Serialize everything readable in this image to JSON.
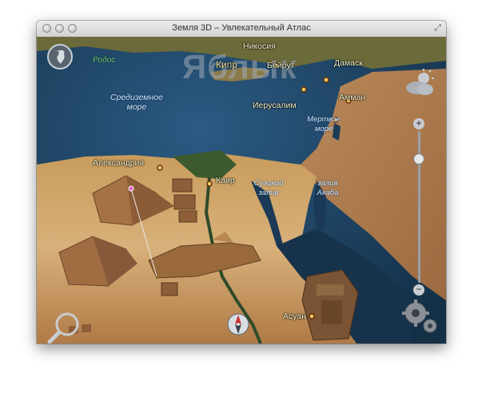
{
  "window": {
    "title": "Земля 3D – Увлекательный Атлас"
  },
  "watermark": "Яблык",
  "cities": [
    {
      "key": "nicosia",
      "label": "Никосия"
    },
    {
      "key": "beirut",
      "label": "Бейрут"
    },
    {
      "key": "damascus",
      "label": "Дамаск"
    },
    {
      "key": "amman",
      "label": "Амман"
    },
    {
      "key": "jerusalem",
      "label": "Иерусалим"
    },
    {
      "key": "alexandria",
      "label": "Александрия"
    },
    {
      "key": "cairo",
      "label": "Каир"
    },
    {
      "key": "aswan",
      "label": "Асуан"
    }
  ],
  "countries": {
    "cyprus": "Кипр"
  },
  "islands": {
    "rhodes": "Родос"
  },
  "seas": {
    "mediterranean": "Средиземное море",
    "dead_sea": "Мертвое море",
    "gulf_suez": "Суэцкий залив",
    "gulf_aqaba": "залив Акаба"
  },
  "controls": {
    "globe": "globe-icon",
    "weather": "weather-icon",
    "zoom_in": "+",
    "zoom_out": "−",
    "zoom_level": 0.2,
    "settings": "gear-icon",
    "search": "magnifier-icon",
    "compass": "compass-icon"
  }
}
